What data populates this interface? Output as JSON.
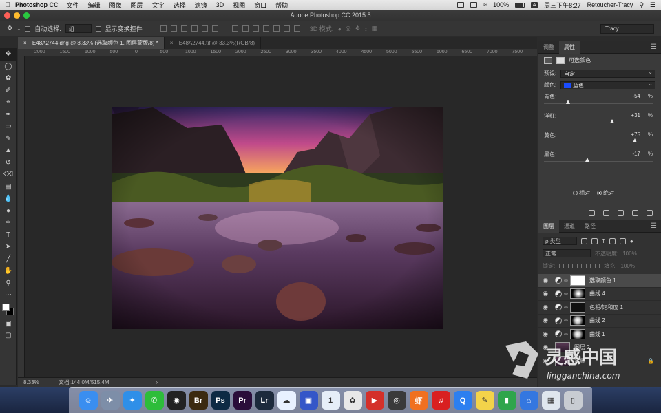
{
  "menubar": {
    "app_name": "Photoshop CC",
    "menus": [
      "文件",
      "编辑",
      "图像",
      "图层",
      "文字",
      "选择",
      "滤镜",
      "3D",
      "视图",
      "窗口",
      "帮助"
    ],
    "battery": "100%",
    "input_method": "A",
    "clock": "周三下午8:27",
    "user": "Retoucher-Tracy"
  },
  "window": {
    "title": "Adobe Photoshop CC 2015.5"
  },
  "options_bar": {
    "auto_select_label": "自动选择:",
    "auto_select_value": "组",
    "show_transform_label": "显示变换控件",
    "mode_3d_label": "3D 模式:",
    "workspace": "Tracy"
  },
  "doc_tabs": [
    {
      "label": "E48A2744.dng @ 8.33% (选取颜色 1, 图层蒙版/8) *",
      "active": true
    },
    {
      "label": "E48A2744.tif @ 33.3%(RGB/8)",
      "active": false
    }
  ],
  "ruler_ticks": [
    "2000",
    "1500",
    "1000",
    "500",
    "0",
    "500",
    "1000",
    "1500",
    "2000",
    "2500",
    "3000",
    "3500",
    "4000",
    "4500",
    "5000",
    "5500",
    "6000",
    "6500",
    "7000",
    "7500"
  ],
  "status_bar": {
    "zoom": "8.33%",
    "doc_size": "文档:144.0M/515.4M",
    "arrow": "›"
  },
  "properties_panel": {
    "tabs": [
      "调整",
      "属性"
    ],
    "header": "可选颜色",
    "preset_label": "预设:",
    "preset_value": "自定",
    "colors_label": "颜色:",
    "colors_value": "蓝色",
    "sliders": [
      {
        "label": "青色:",
        "value": "-54",
        "unit": "%",
        "level": 0.23
      },
      {
        "label": "洋红:",
        "value": "+31",
        "unit": "%",
        "level": 0.655
      },
      {
        "label": "黄色:",
        "value": "+75",
        "unit": "%",
        "level": 0.875
      },
      {
        "label": "黑色:",
        "value": "-17",
        "unit": "%",
        "level": 0.415
      }
    ],
    "method_relative": "相对",
    "method_absolute": "绝对"
  },
  "layers_panel": {
    "tabs": [
      "图层",
      "通道",
      "路径"
    ],
    "filter_kind": "ρ 类型",
    "blend_mode": "正常",
    "opacity_label": "不透明度:",
    "opacity_value": "100%",
    "lock_label": "锁定:",
    "fill_label": "填充:",
    "fill_value": "100%",
    "layers": [
      {
        "name": "选取颜色 1",
        "mask": "white",
        "selected": true
      },
      {
        "name": "曲线 4",
        "mask": "blob",
        "selected": false
      },
      {
        "name": "色相/饱和度 1",
        "mask": "dark",
        "selected": false
      },
      {
        "name": "曲线 2",
        "mask": "radial",
        "selected": false
      },
      {
        "name": "曲线 1",
        "mask": "radial",
        "selected": false
      },
      {
        "name": "图层 2",
        "mask": "photo",
        "selected": false
      },
      {
        "name": "背景",
        "mask": "photo",
        "selected": false
      }
    ]
  },
  "dock": {
    "apps": [
      {
        "icon": "finder-icon",
        "glyph": "☺",
        "color": "#3a8ef0"
      },
      {
        "icon": "launchpad-icon",
        "glyph": "✈",
        "color": "#7d8ea8"
      },
      {
        "icon": "safari-icon",
        "glyph": "✦",
        "color": "#2f8fe8"
      },
      {
        "icon": "wechat-icon",
        "glyph": "✆",
        "color": "#2dbd3a"
      },
      {
        "icon": "qq-icon",
        "glyph": "◉",
        "color": "#222222"
      },
      {
        "icon": "bridge-icon",
        "glyph": "Br",
        "color": "#3b2a10"
      },
      {
        "icon": "photoshop-icon",
        "glyph": "Ps",
        "color": "#0d2a44"
      },
      {
        "icon": "premiere-icon",
        "glyph": "Pr",
        "color": "#2a0d3a"
      },
      {
        "icon": "lightroom-icon",
        "glyph": "Lr",
        "color": "#1c2a3c"
      },
      {
        "icon": "baidu-cloud-icon",
        "glyph": "☁",
        "color": "#e8f1ff"
      },
      {
        "icon": "screen-recorder-icon",
        "glyph": "▣",
        "color": "#3456c8"
      },
      {
        "icon": "1password-icon",
        "glyph": "1",
        "color": "#e6eef8"
      },
      {
        "icon": "davinci-icon",
        "glyph": "✿",
        "color": "#e8e8e8"
      },
      {
        "icon": "video-player-icon",
        "glyph": "▶",
        "color": "#d4302a"
      },
      {
        "icon": "obs-icon",
        "glyph": "◎",
        "color": "#3a3a3a"
      },
      {
        "icon": "xiami-icon",
        "glyph": "虾",
        "color": "#f07020"
      },
      {
        "icon": "netease-music-icon",
        "glyph": "♫",
        "color": "#d92020"
      },
      {
        "icon": "qq-browser-icon",
        "glyph": "Q",
        "color": "#2c7ff0"
      },
      {
        "icon": "notes-icon",
        "glyph": "✎",
        "color": "#f3d34a"
      },
      {
        "icon": "numbers-icon",
        "glyph": "▮",
        "color": "#2fa54b"
      },
      {
        "icon": "keynote-icon",
        "glyph": "⌂",
        "color": "#3477e0"
      },
      {
        "icon": "preview-icon",
        "glyph": "▦",
        "color": "#dfe6ee"
      },
      {
        "icon": "trash-icon",
        "glyph": "▯",
        "color": "#c8ccd2"
      }
    ]
  },
  "watermark": {
    "brand_cn": "灵感中国",
    "domain": "lingganchina.com"
  }
}
